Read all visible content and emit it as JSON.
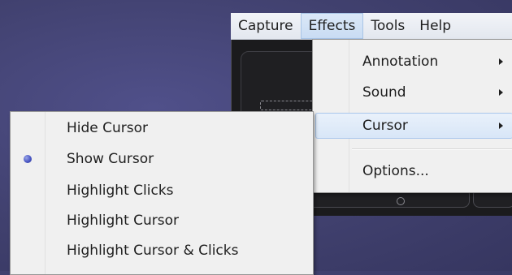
{
  "menubar": {
    "items": [
      {
        "label": "Capture",
        "active": false
      },
      {
        "label": "Effects",
        "active": true
      },
      {
        "label": "Tools",
        "active": false
      },
      {
        "label": "Help",
        "active": false
      }
    ]
  },
  "effects_menu": {
    "items": [
      {
        "label": "Annotation",
        "has_submenu": true
      },
      {
        "label": "Sound",
        "has_submenu": true
      },
      {
        "label": "Cursor",
        "has_submenu": true,
        "highlighted": true
      },
      {
        "label": "Options...",
        "has_submenu": false
      }
    ]
  },
  "cursor_submenu": {
    "items": [
      {
        "label": "Hide Cursor",
        "selected": false
      },
      {
        "label": "Show Cursor",
        "selected": true
      },
      {
        "label": "Highlight Clicks",
        "selected": false
      },
      {
        "label": "Highlight Cursor",
        "selected": false
      },
      {
        "label": "Highlight Cursor & Clicks",
        "selected": false
      }
    ]
  },
  "colors": {
    "desktop": "#41416f",
    "menu_bg": "#f0f0f0",
    "highlight_border": "#a9c6ec",
    "radio_accent": "#4b58c4"
  }
}
